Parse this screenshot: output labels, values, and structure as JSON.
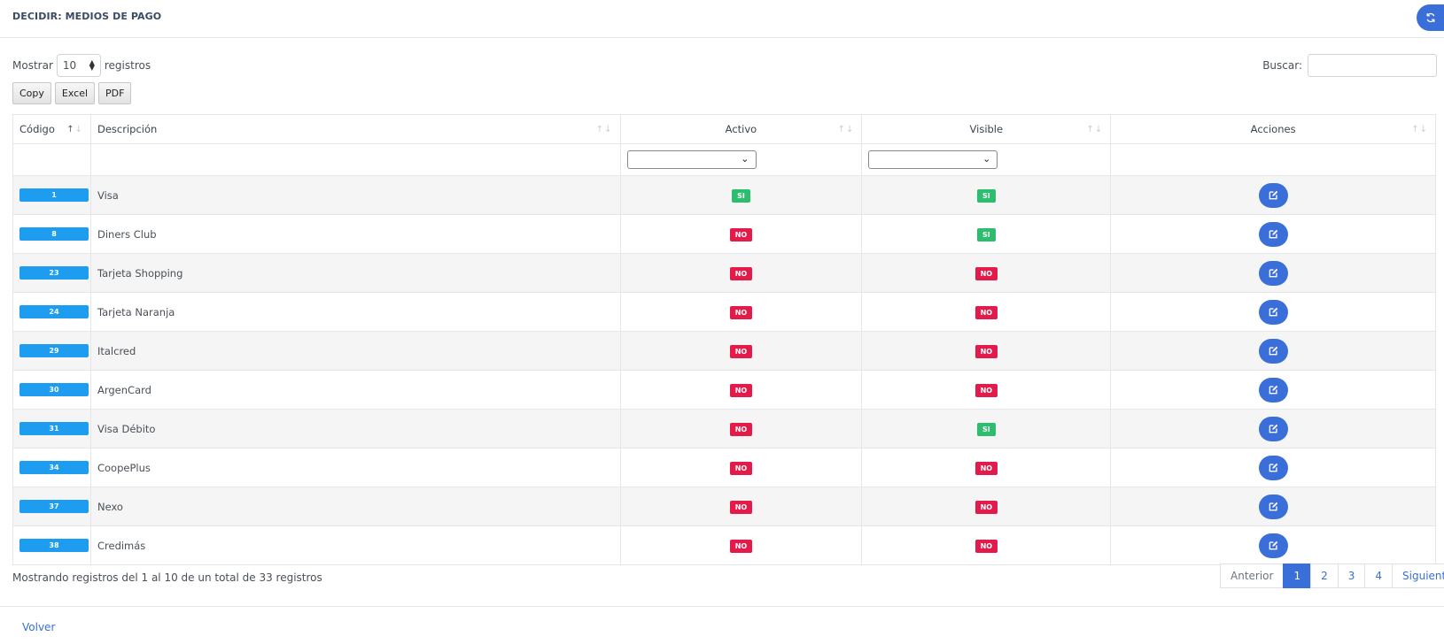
{
  "header": {
    "title": "DECIDIR: MEDIOS DE PAGO",
    "refresh_icon": "refresh-icon"
  },
  "length": {
    "show_label": "Mostrar",
    "value": "10",
    "records_label": "registros"
  },
  "search": {
    "label": "Buscar:",
    "value": ""
  },
  "buttons": {
    "copy": "Copy",
    "excel": "Excel",
    "pdf": "PDF"
  },
  "columns": {
    "code": "Código",
    "description": "Descripción",
    "active": "Activo",
    "visible": "Visible",
    "actions": "Acciones"
  },
  "filters": {
    "active_value": "",
    "visible_value": ""
  },
  "rows": [
    {
      "code": "1",
      "description": "Visa",
      "active": "SI",
      "visible": "SI"
    },
    {
      "code": "8",
      "description": "Diners Club",
      "active": "NO",
      "visible": "SI"
    },
    {
      "code": "23",
      "description": "Tarjeta Shopping",
      "active": "NO",
      "visible": "NO"
    },
    {
      "code": "24",
      "description": "Tarjeta Naranja",
      "active": "NO",
      "visible": "NO"
    },
    {
      "code": "29",
      "description": "Italcred",
      "active": "NO",
      "visible": "NO"
    },
    {
      "code": "30",
      "description": "ArgenCard",
      "active": "NO",
      "visible": "NO"
    },
    {
      "code": "31",
      "description": "Visa Débito",
      "active": "NO",
      "visible": "SI"
    },
    {
      "code": "34",
      "description": "CoopePlus",
      "active": "NO",
      "visible": "NO"
    },
    {
      "code": "37",
      "description": "Nexo",
      "active": "NO",
      "visible": "NO"
    },
    {
      "code": "38",
      "description": "Credimás",
      "active": "NO",
      "visible": "NO"
    }
  ],
  "info": "Mostrando registros del 1 al 10 de un total de 33 registros",
  "pagination": {
    "previous": "Anterior",
    "pages": [
      "1",
      "2",
      "3",
      "4"
    ],
    "current": "1",
    "next": "Siguiente"
  },
  "footer": {
    "back": "Volver"
  },
  "colors": {
    "primary": "#3a6ed8",
    "code_badge": "#1e9cf0",
    "si": "#2dbd6e",
    "no": "#e31b4b"
  }
}
